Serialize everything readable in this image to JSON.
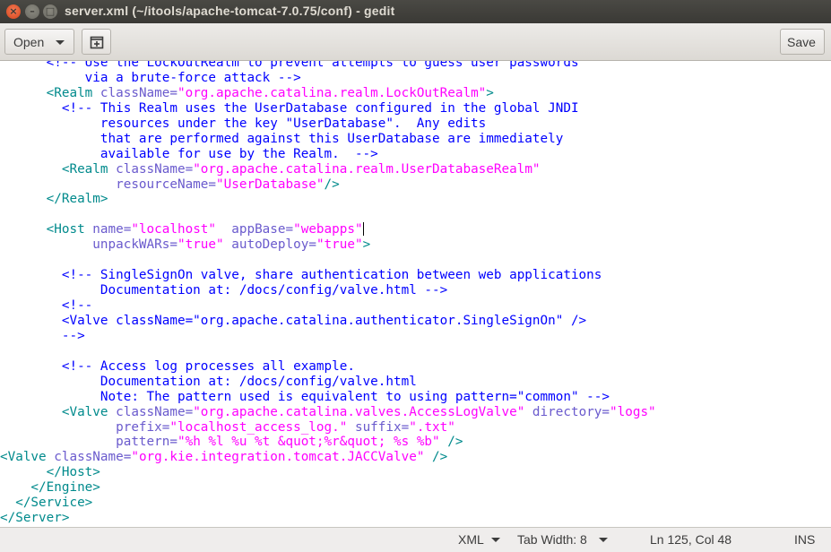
{
  "window": {
    "title": "server.xml (~/itools/apache-tomcat-7.0.75/conf) - gedit",
    "close_glyph": "×",
    "min_glyph": "–",
    "max_glyph": "□"
  },
  "toolbar": {
    "open_label": "Open",
    "save_label": "Save",
    "new_tab_icon": "new-tab-icon"
  },
  "editor": {
    "language": "XML",
    "lines": [
      [
        {
          "t": "com",
          "s": "      <!-- Use the LockOutRealm to prevent attempts to guess user passwords"
        }
      ],
      [
        {
          "t": "com",
          "s": "           via a brute-force attack -->"
        }
      ],
      [
        {
          "t": "tag",
          "s": "      <Realm "
        },
        {
          "t": "attr",
          "s": "className="
        },
        {
          "t": "val",
          "s": "\"org.apache.catalina.realm.LockOutRealm\""
        },
        {
          "t": "tag",
          "s": ">"
        }
      ],
      [
        {
          "t": "com",
          "s": "        <!-- This Realm uses the UserDatabase configured in the global JNDI"
        }
      ],
      [
        {
          "t": "com",
          "s": "             resources under the key \"UserDatabase\".  Any edits"
        }
      ],
      [
        {
          "t": "com",
          "s": "             that are performed against this UserDatabase are immediately"
        }
      ],
      [
        {
          "t": "com",
          "s": "             available for use by the Realm.  -->"
        }
      ],
      [
        {
          "t": "tag",
          "s": "        <Realm "
        },
        {
          "t": "attr",
          "s": "className="
        },
        {
          "t": "val",
          "s": "\"org.apache.catalina.realm.UserDatabaseRealm\""
        }
      ],
      [
        {
          "t": "attr",
          "s": "               resourceName="
        },
        {
          "t": "val",
          "s": "\"UserDatabase\""
        },
        {
          "t": "tag",
          "s": "/>"
        }
      ],
      [
        {
          "t": "tag",
          "s": "      </Realm>"
        }
      ],
      [
        {
          "t": "text",
          "s": ""
        }
      ],
      [
        {
          "t": "tag",
          "s": "      <Host "
        },
        {
          "t": "attr",
          "s": "name="
        },
        {
          "t": "val",
          "s": "\"localhost\""
        },
        {
          "t": "attr",
          "s": "  appBase="
        },
        {
          "t": "val",
          "s": "\"webapps\""
        },
        {
          "t": "caret",
          "s": ""
        }
      ],
      [
        {
          "t": "attr",
          "s": "            unpackWARs="
        },
        {
          "t": "val",
          "s": "\"true\""
        },
        {
          "t": "attr",
          "s": " autoDeploy="
        },
        {
          "t": "val",
          "s": "\"true\""
        },
        {
          "t": "tag",
          "s": ">"
        }
      ],
      [
        {
          "t": "text",
          "s": ""
        }
      ],
      [
        {
          "t": "com",
          "s": "        <!-- SingleSignOn valve, share authentication between web applications"
        }
      ],
      [
        {
          "t": "com",
          "s": "             Documentation at: /docs/config/valve.html -->"
        }
      ],
      [
        {
          "t": "com",
          "s": "        <!--"
        }
      ],
      [
        {
          "t": "com",
          "s": "        <Valve className=\"org.apache.catalina.authenticator.SingleSignOn\" />"
        }
      ],
      [
        {
          "t": "com",
          "s": "        -->"
        }
      ],
      [
        {
          "t": "text",
          "s": ""
        }
      ],
      [
        {
          "t": "com",
          "s": "        <!-- Access log processes all example."
        }
      ],
      [
        {
          "t": "com",
          "s": "             Documentation at: /docs/config/valve.html"
        }
      ],
      [
        {
          "t": "com",
          "s": "             Note: The pattern used is equivalent to using pattern=\"common\" -->"
        }
      ],
      [
        {
          "t": "tag",
          "s": "        <Valve "
        },
        {
          "t": "attr",
          "s": "className="
        },
        {
          "t": "val",
          "s": "\"org.apache.catalina.valves.AccessLogValve\""
        },
        {
          "t": "attr",
          "s": " directory="
        },
        {
          "t": "val",
          "s": "\"logs\""
        }
      ],
      [
        {
          "t": "attr",
          "s": "               prefix="
        },
        {
          "t": "val",
          "s": "\"localhost_access_log.\""
        },
        {
          "t": "attr",
          "s": " suffix="
        },
        {
          "t": "val",
          "s": "\".txt\""
        }
      ],
      [
        {
          "t": "attr",
          "s": "               pattern="
        },
        {
          "t": "val",
          "s": "\"%h %l %u %t &quot;%r&quot; %s %b\""
        },
        {
          "t": "tag",
          "s": " />"
        }
      ],
      [
        {
          "t": "tag",
          "s": "<Valve "
        },
        {
          "t": "attr",
          "s": "className="
        },
        {
          "t": "val",
          "s": "\"org.kie.integration.tomcat.JACCValve\""
        },
        {
          "t": "tag",
          "s": " />"
        }
      ],
      [
        {
          "t": "tag",
          "s": "      </Host>"
        }
      ],
      [
        {
          "t": "tag",
          "s": "    </Engine>"
        }
      ],
      [
        {
          "t": "tag",
          "s": "  </Service>"
        }
      ],
      [
        {
          "t": "tag",
          "s": "</Server>"
        }
      ]
    ]
  },
  "statusbar": {
    "language": "XML",
    "tab_width": "Tab Width: 8",
    "position": "Ln 125, Col 48",
    "mode": "INS"
  }
}
